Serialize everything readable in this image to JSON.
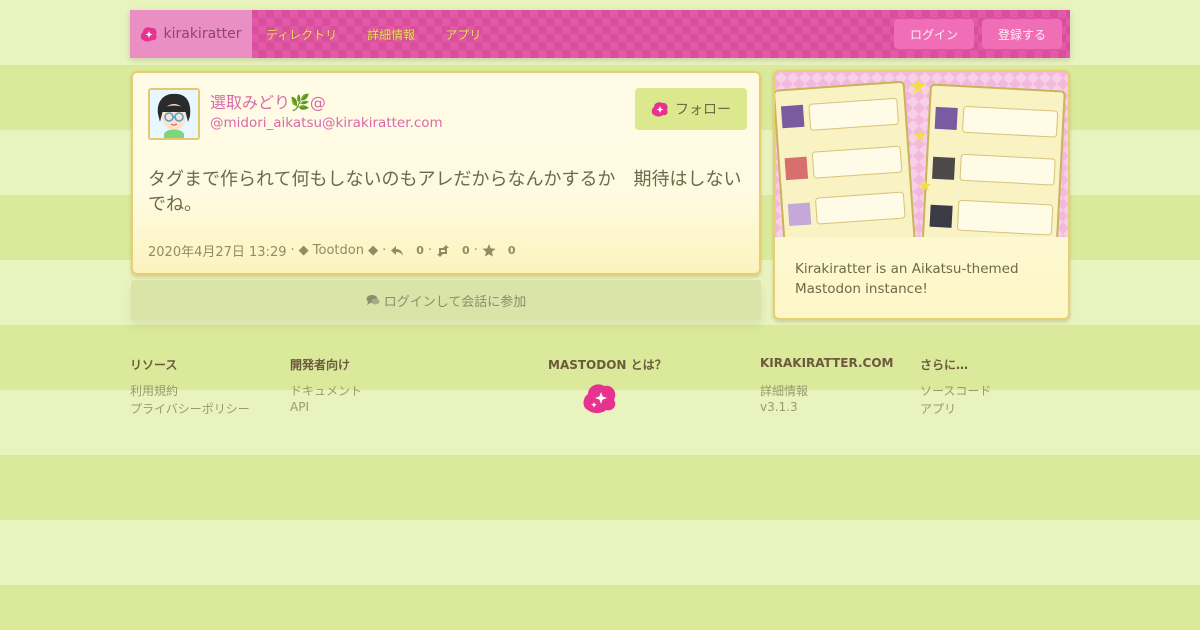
{
  "nav": {
    "brand": "kirakiratter",
    "links": [
      "ディレクトリ",
      "詳細情報",
      "アプリ"
    ],
    "login": "ログイン",
    "register": "登録する"
  },
  "status": {
    "display_name": "選取みどり🌿@",
    "acct": "@midori_aikatsu@kirakiratter.com",
    "follow": "フォロー",
    "content": "タグまで作られて何もしないのもアレだからなんかするか　期待はしないでね。",
    "date": "2020年4月27日 13:29",
    "app": "◆ Tootdon ◆",
    "replies": "0",
    "boosts": "0",
    "favourites": "0",
    "join": "ログインして会話に参加"
  },
  "side": {
    "description": "Kirakiratter is an Aikatsu-themed Mastodon instance!"
  },
  "footer": {
    "resources": {
      "title": "リソース",
      "links": [
        "利用規約",
        "プライバシーポリシー"
      ]
    },
    "developers": {
      "title": "開発者向け",
      "links": [
        "ドキュメント",
        "API"
      ]
    },
    "mastodon": {
      "title": "MASTODON とは？"
    },
    "instance": {
      "title": "KIRAKIRATTER.COM",
      "links": [
        "詳細情報",
        "v3.1.3"
      ]
    },
    "more": {
      "title": "さらに…",
      "links": [
        "ソースコード",
        "アプリ"
      ]
    }
  }
}
